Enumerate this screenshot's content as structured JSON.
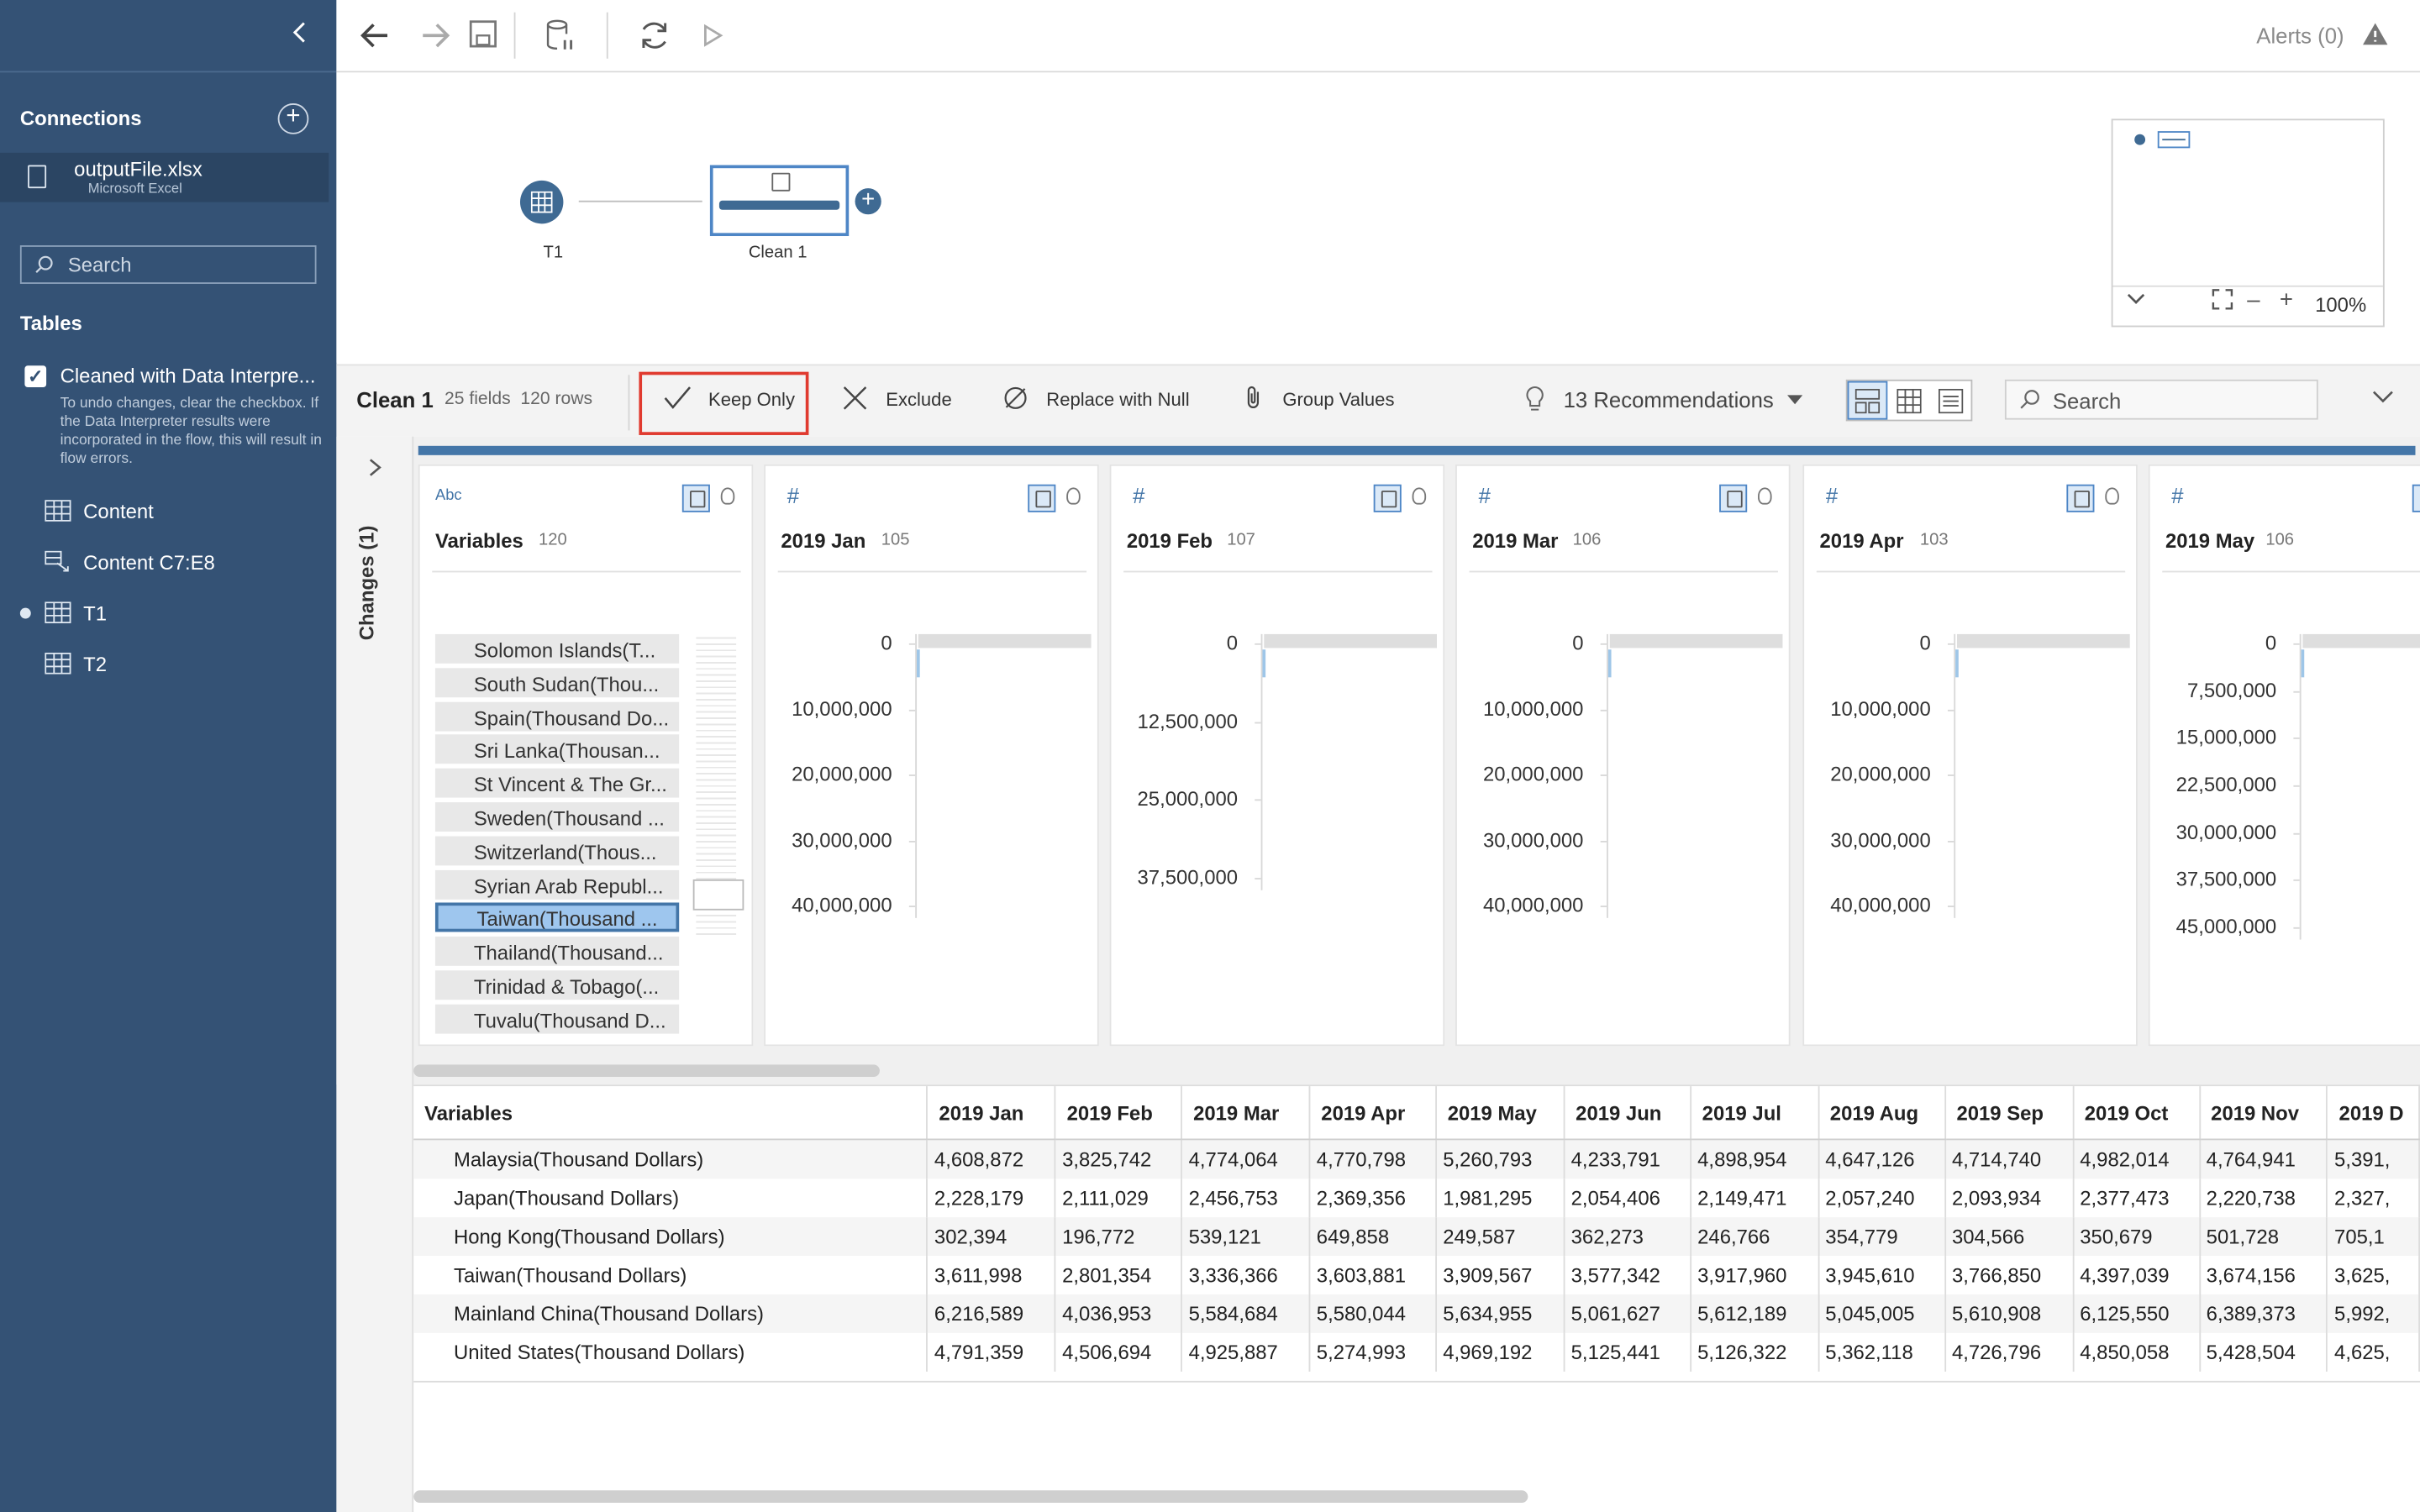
{
  "sidebar": {
    "connections_title": "Connections",
    "connection": {
      "name": "outputFile.xlsx",
      "type": "Microsoft Excel"
    },
    "search_placeholder": "Search",
    "tables_title": "Tables",
    "interpreter_label": "Cleaned with Data Interpre...",
    "interpreter_note": "To undo changes, clear the checkbox. If the Data Interpreter results were incorporated in the flow, this will result in flow errors.",
    "tables": [
      {
        "label": "Content",
        "icon": "table-icon"
      },
      {
        "label": "Content C7:E8",
        "icon": "named-range-icon"
      },
      {
        "label": "T1",
        "icon": "table-icon",
        "active": true
      },
      {
        "label": "T2",
        "icon": "table-icon"
      }
    ]
  },
  "toolbar": {
    "alerts": "Alerts (0)"
  },
  "flow": {
    "nodes": [
      {
        "label": "T1"
      },
      {
        "label": "Clean 1"
      }
    ],
    "zoom": "100%"
  },
  "step": {
    "name": "Clean 1",
    "meta": "25 fields  120 rows",
    "actions": {
      "keep_only": "Keep Only",
      "exclude": "Exclude",
      "replace_null": "Replace with Null",
      "group_values": "Group Values"
    },
    "recommendations": "13 Recommendations",
    "search_placeholder": "Search"
  },
  "changes_label": "Changes (1)",
  "profile": {
    "variables_card": {
      "type": "Abc",
      "name": "Variables",
      "count": "120",
      "values": [
        "Solomon Islands(T...",
        "South Sudan(Thou...",
        "Spain(Thousand Do...",
        "Sri Lanka(Thousan...",
        "St Vincent & The Gr...",
        "Sweden(Thousand ...",
        "Switzerland(Thous...",
        "Syrian Arab Republ...",
        "Taiwan(Thousand ...",
        "Thailand(Thousand...",
        "Trinidad & Tobago(...",
        "Tuvalu(Thousand D..."
      ],
      "selected_index": 8
    },
    "numeric_cards": [
      {
        "type": "#",
        "name": "2019 Jan",
        "count": "105",
        "ticks": [
          "0",
          "10,000,000",
          "20,000,000",
          "30,000,000",
          "40,000,000"
        ]
      },
      {
        "type": "#",
        "name": "2019 Feb",
        "count": "107",
        "ticks": [
          "0",
          "12,500,000",
          "25,000,000",
          "37,500,000"
        ]
      },
      {
        "type": "#",
        "name": "2019 Mar",
        "count": "106",
        "ticks": [
          "0",
          "10,000,000",
          "20,000,000",
          "30,000,000",
          "40,000,000"
        ]
      },
      {
        "type": "#",
        "name": "2019 Apr",
        "count": "103",
        "ticks": [
          "0",
          "10,000,000",
          "20,000,000",
          "30,000,000",
          "40,000,000"
        ]
      },
      {
        "type": "#",
        "name": "2019 May",
        "count": "106",
        "ticks": [
          "0",
          "7,500,000",
          "15,000,000",
          "22,500,000",
          "30,000,000",
          "37,500,000",
          "45,000,000"
        ]
      }
    ]
  },
  "grid": {
    "columns": [
      "Variables",
      "2019 Jan",
      "2019 Feb",
      "2019 Mar",
      "2019 Apr",
      "2019 May",
      "2019 Jun",
      "2019 Jul",
      "2019 Aug",
      "2019 Sep",
      "2019 Oct",
      "2019 Nov",
      "2019 D"
    ],
    "rows": [
      [
        "Malaysia(Thousand Dollars)",
        "4,608,872",
        "3,825,742",
        "4,774,064",
        "4,770,798",
        "5,260,793",
        "4,233,791",
        "4,898,954",
        "4,647,126",
        "4,714,740",
        "4,982,014",
        "4,764,941",
        "5,391,"
      ],
      [
        "Japan(Thousand Dollars)",
        "2,228,179",
        "2,111,029",
        "2,456,753",
        "2,369,356",
        "1,981,295",
        "2,054,406",
        "2,149,471",
        "2,057,240",
        "2,093,934",
        "2,377,473",
        "2,220,738",
        "2,327,"
      ],
      [
        "Hong Kong(Thousand Dollars)",
        "302,394",
        "196,772",
        "539,121",
        "649,858",
        "249,587",
        "362,273",
        "246,766",
        "354,779",
        "304,566",
        "350,679",
        "501,728",
        "705,1"
      ],
      [
        "Taiwan(Thousand Dollars)",
        "3,611,998",
        "2,801,354",
        "3,336,366",
        "3,603,881",
        "3,909,567",
        "3,577,342",
        "3,917,960",
        "3,945,610",
        "3,766,850",
        "4,397,039",
        "3,674,156",
        "3,625,"
      ],
      [
        "Mainland China(Thousand Dollars)",
        "6,216,589",
        "4,036,953",
        "5,584,684",
        "5,580,044",
        "5,634,955",
        "5,061,627",
        "5,612,189",
        "5,045,005",
        "5,610,908",
        "6,125,550",
        "6,389,373",
        "5,992,"
      ],
      [
        "United States(Thousand Dollars)",
        "4,791,359",
        "4,506,694",
        "4,925,887",
        "5,274,993",
        "4,969,192",
        "5,125,441",
        "5,126,322",
        "5,362,118",
        "4,726,796",
        "4,850,058",
        "5,428,504",
        "4,625,"
      ]
    ]
  }
}
